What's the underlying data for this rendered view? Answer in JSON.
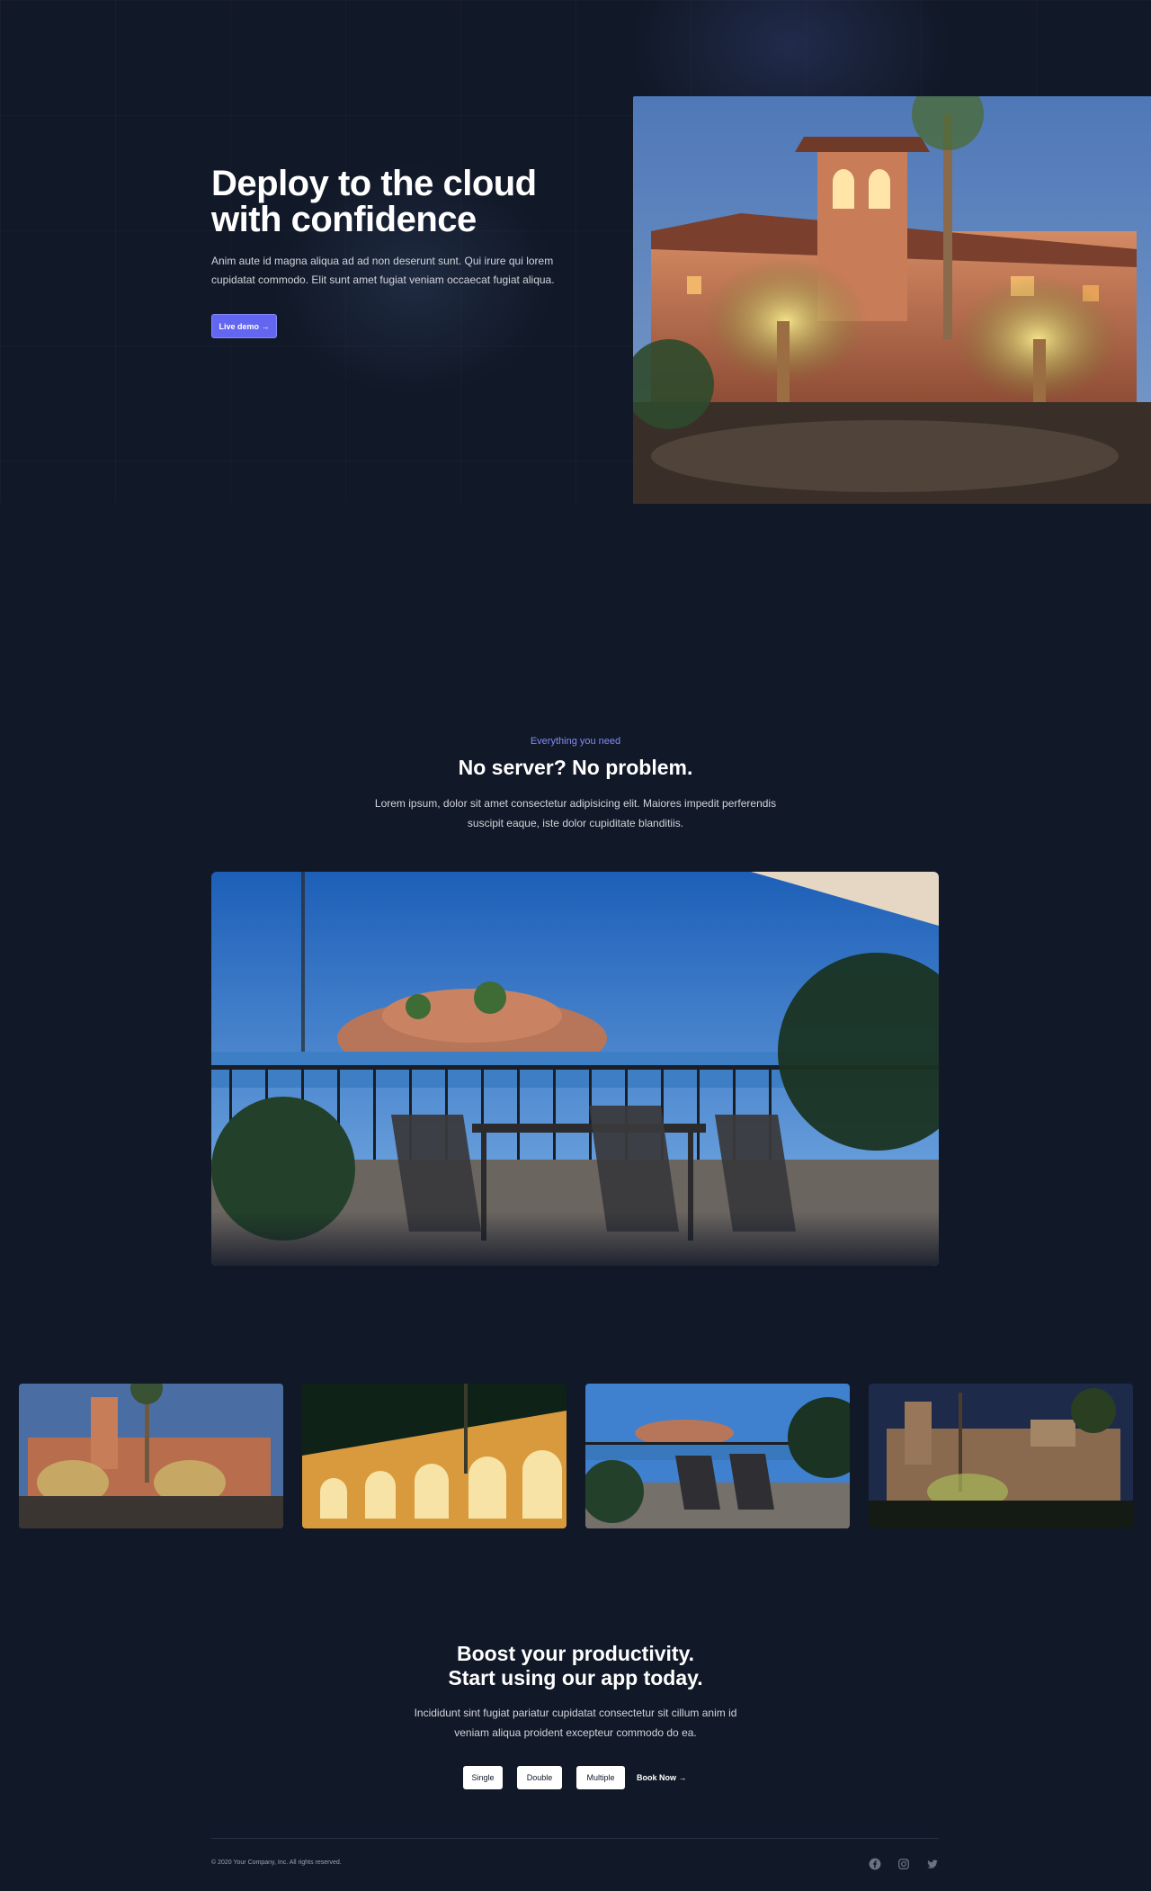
{
  "hero": {
    "title_line1": "Deploy to the cloud",
    "title_line2": "with confidence",
    "description": "Anim aute id magna aliqua ad ad non deserunt sunt. Qui irure qui lorem cupidatat commodo. Elit sunt amet fugiat veniam occaecat fugiat aliqua.",
    "cta_label": "Live demo →"
  },
  "feature": {
    "eyebrow": "Everything you need",
    "title": "No server? No problem.",
    "description": "Lorem ipsum, dolor sit amet consectetur adipisicing elit. Maiores impedit perferendis suscipit eaque, iste dolor cupiditate blanditiis."
  },
  "cta": {
    "title_line1": "Boost your productivity.",
    "title_line2": "Start using our app today.",
    "description": "Incididunt sint fugiat pariatur cupidatat consectetur sit cillum anim id veniam aliqua proident excepteur commodo do ea.",
    "options": [
      "Single",
      "Double",
      "Multiple"
    ],
    "book_label": "Book Now →"
  },
  "footer": {
    "copyright": "© 2020 Your Company, Inc. All rights reserved."
  },
  "icons": {
    "social": [
      "facebook-icon",
      "instagram-icon",
      "twitter-icon"
    ]
  },
  "colors": {
    "background": "#111827",
    "accent": "#6366f1",
    "eyebrow": "#818cf8",
    "muted_text": "#d1d5db"
  }
}
